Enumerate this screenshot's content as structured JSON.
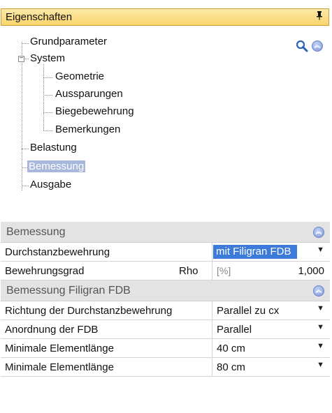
{
  "panel": {
    "title": "Eigenschaften",
    "pin_glyph": "q"
  },
  "tree": {
    "items": [
      {
        "label": "Grundparameter"
      },
      {
        "label": "System"
      },
      {
        "label": "Geometrie"
      },
      {
        "label": "Aussparungen"
      },
      {
        "label": "Biegebewehrung"
      },
      {
        "label": "Bemerkungen"
      },
      {
        "label": "Belastung"
      },
      {
        "label": "Bemessung",
        "selected": true
      },
      {
        "label": "Ausgabe"
      }
    ]
  },
  "icons": {
    "search": "search-icon",
    "collapse": "collapse-icon"
  },
  "sections": {
    "bemessung": {
      "title": "Bemessung",
      "rows": {
        "durchstanz": {
          "caption": "Durchstanzbewehrung",
          "value": "mit Filigran FDB"
        },
        "grad": {
          "caption": "Bewehrungsgrad",
          "symbol": "Rho",
          "unit": "[%]",
          "value": "1,000"
        }
      }
    },
    "filigran": {
      "title": "Bemessung Filigran FDB",
      "rows": {
        "richtung": {
          "caption": "Richtung der Durchstanzbewehrung",
          "value": "Parallel zu cx"
        },
        "anordnung": {
          "caption": "Anordnung der FDB",
          "value": "Parallel"
        },
        "min1": {
          "caption": "Minimale Elementlänge",
          "value": "40 cm"
        },
        "min2": {
          "caption": "Minimale Elementlänge",
          "value": "80 cm"
        }
      }
    }
  },
  "colors": {
    "header": "#f9d46b",
    "selection": "#a8b8dc",
    "highlight": "#3c7bd9"
  }
}
